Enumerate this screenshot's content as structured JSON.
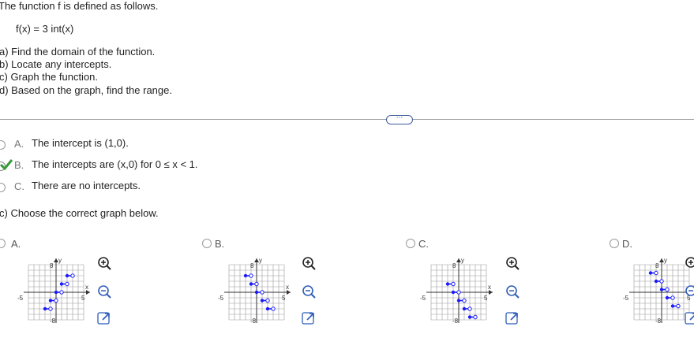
{
  "problem": {
    "intro": "The function f is defined as follows.",
    "function": "f(x) = 3 int(x)",
    "parts": [
      "a) Find the domain of the function.",
      "b) Locate any intercepts.",
      "c) Graph the function.",
      "d) Based on the graph, find the range."
    ]
  },
  "more_button": "···",
  "intercept_options": [
    {
      "letter": "A.",
      "text": "The intercept is (1,0).",
      "selected": false
    },
    {
      "letter": "B.",
      "text": "The intercepts are (x,0) for 0 ≤ x < 1.",
      "selected": true
    },
    {
      "letter": "C.",
      "text": "There are no intercepts.",
      "selected": false
    }
  ],
  "graph_prompt": "c) Choose the correct graph below.",
  "graph_options": [
    {
      "letter": "A.",
      "axis": {
        "x": "x",
        "y": "y",
        "tick_pos": "5",
        "tick_neg": "-5",
        "y_top": "8",
        "y_bot": "-8"
      }
    },
    {
      "letter": "B.",
      "axis": {
        "x": "x",
        "y": "y",
        "tick_pos": "5",
        "tick_neg": "-5",
        "y_top": "8",
        "y_bot": "-8"
      }
    },
    {
      "letter": "C.",
      "axis": {
        "x": "x",
        "y": "y",
        "tick_pos": "5",
        "tick_neg": "-5",
        "y_top": "8",
        "y_bot": "-8"
      }
    },
    {
      "letter": "D.",
      "axis": {
        "x": "x",
        "y": "y",
        "tick_pos": "5",
        "tick_neg": "-5",
        "y_top": "8",
        "y_bot": "-8"
      }
    }
  ],
  "colors": {
    "accent": "#2f5db8",
    "check": "#3a9a3a",
    "segment": "#1a1aff",
    "grid": "#9a9a9a"
  },
  "icons": [
    "zoom-in-icon",
    "zoom-out-icon",
    "expand-icon"
  ]
}
